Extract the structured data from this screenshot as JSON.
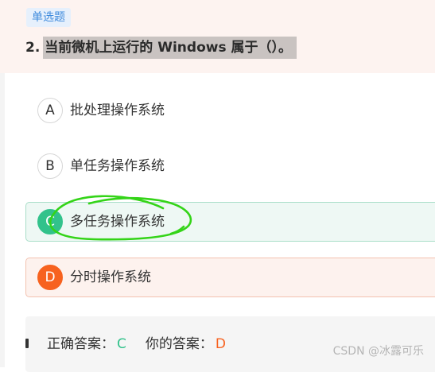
{
  "question": {
    "type_badge": "单选题",
    "number": "2.",
    "text": "当前微机上运行的 Windows 属于（）。"
  },
  "options": [
    {
      "letter": "A",
      "text": "批处理操作系统",
      "state": "normal"
    },
    {
      "letter": "B",
      "text": "单任务操作系统",
      "state": "normal"
    },
    {
      "letter": "C",
      "text": "多任务操作系统",
      "state": "correct"
    },
    {
      "letter": "D",
      "text": "分时操作系统",
      "state": "wrong"
    }
  ],
  "answer": {
    "correct_label": "正确答案：",
    "correct_value": "C",
    "yours_label": "你的答案：",
    "yours_value": "D"
  },
  "watermark": "CSDN @冰露可乐",
  "colors": {
    "correct": "#32c28b",
    "wrong": "#f7621f",
    "badge_text": "#3f8bdd",
    "annotation": "#34d418"
  }
}
